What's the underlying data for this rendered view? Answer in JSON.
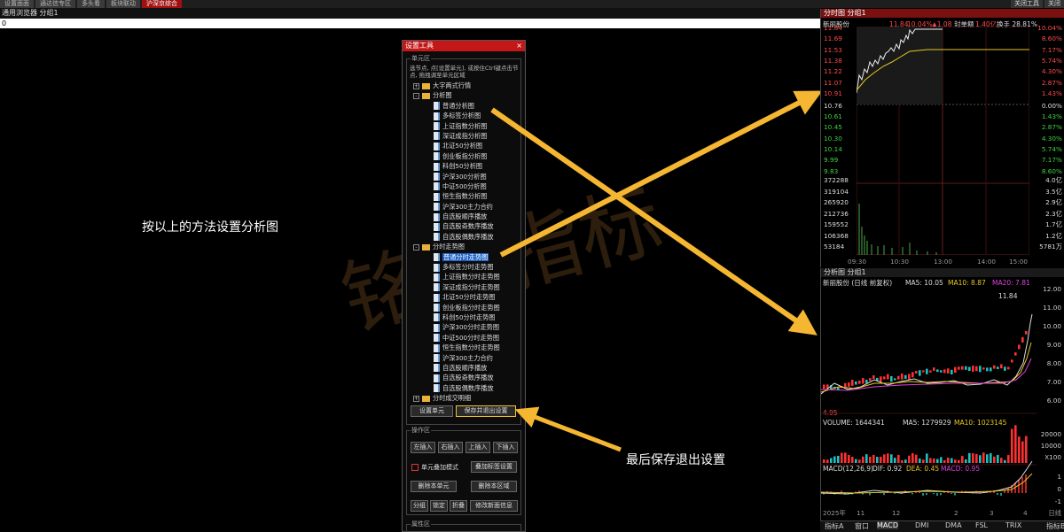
{
  "top_tabs": [
    "设置面面",
    "通达信专区",
    "多头看",
    "板块联动",
    "沪深京综合"
  ],
  "top_right": [
    "关闭工具",
    "关闭"
  ],
  "window_title": "通用浏览器 分组1",
  "address_value": "0",
  "annotations": {
    "left": "按以上的方法设置分析图",
    "bottom": "最后保存退出设置"
  },
  "watermark": "铭…指标",
  "dialog": {
    "title": "设置工具",
    "close": "×",
    "unit_group": "单元区",
    "hint": "选节点, 点[设置单元], 或按住Ctrl键点击节点, 拖拽调至单元区域",
    "tree": [
      {
        "label": "大字两式行情",
        "level": 0,
        "expand": "+",
        "type": "folder"
      },
      {
        "label": "分析图",
        "level": 0,
        "expand": "-",
        "type": "folder"
      },
      {
        "label": "普通分析图",
        "level": 1,
        "type": "doc"
      },
      {
        "label": "多标签分析图",
        "level": 1,
        "type": "doc"
      },
      {
        "label": "上证指数分析图",
        "level": 1,
        "type": "doc"
      },
      {
        "label": "深证成指分析图",
        "level": 1,
        "type": "doc"
      },
      {
        "label": "北证50分析图",
        "level": 1,
        "type": "doc"
      },
      {
        "label": "创业板指分析图",
        "level": 1,
        "type": "doc"
      },
      {
        "label": "科创50分析图",
        "level": 1,
        "type": "doc"
      },
      {
        "label": "沪深300分析图",
        "level": 1,
        "type": "doc"
      },
      {
        "label": "中证500分析图",
        "level": 1,
        "type": "doc"
      },
      {
        "label": "恒生指数分析图",
        "level": 1,
        "type": "doc"
      },
      {
        "label": "沪深300主力合约",
        "level": 1,
        "type": "doc"
      },
      {
        "label": "自选股顺序播放",
        "level": 1,
        "type": "doc"
      },
      {
        "label": "自选股奇数序播放",
        "level": 1,
        "type": "doc"
      },
      {
        "label": "自选股偶数序播放",
        "level": 1,
        "type": "doc"
      },
      {
        "label": "分时走势图",
        "level": 0,
        "expand": "-",
        "type": "folder"
      },
      {
        "label": "普通分时走势图",
        "level": 1,
        "type": "doc",
        "selected": true
      },
      {
        "label": "多标签分时走势图",
        "level": 1,
        "type": "doc"
      },
      {
        "label": "上证指数分时走势图",
        "level": 1,
        "type": "doc"
      },
      {
        "label": "深证成指分时走势图",
        "level": 1,
        "type": "doc"
      },
      {
        "label": "北证50分时走势图",
        "level": 1,
        "type": "doc"
      },
      {
        "label": "创业板指分时走势图",
        "level": 1,
        "type": "doc"
      },
      {
        "label": "科创50分时走势图",
        "level": 1,
        "type": "doc"
      },
      {
        "label": "沪深300分时走势图",
        "level": 1,
        "type": "doc"
      },
      {
        "label": "中证500分时走势图",
        "level": 1,
        "type": "doc"
      },
      {
        "label": "恒生指数分时走势图",
        "level": 1,
        "type": "doc"
      },
      {
        "label": "沪深300主力合约",
        "level": 1,
        "type": "doc"
      },
      {
        "label": "自选股顺序播放",
        "level": 1,
        "type": "doc"
      },
      {
        "label": "自选股奇数序播放",
        "level": 1,
        "type": "doc"
      },
      {
        "label": "自选股偶数序播放",
        "level": 1,
        "type": "doc"
      },
      {
        "label": "分时成交明细",
        "level": 0,
        "expand": "+",
        "type": "folder"
      }
    ],
    "set_unit": "设置单元",
    "save_exit": "保存并退出设置",
    "ops_group": "操作区",
    "ops": {
      "insert_left": "左插入",
      "insert_right": "右插入",
      "insert_top": "上插入",
      "insert_bottom": "下插入",
      "overlay_mode": "单元叠加模式",
      "overlay_tab_settings": "叠加标签设置",
      "delete_unit": "删除本单元",
      "delete_area": "删除本区域",
      "split": "分组",
      "lock": "锁定",
      "fold": "折叠",
      "edit_info": "修改新面信息"
    },
    "attr_group": "属性区"
  },
  "intraday": {
    "header": "分时图 分组1",
    "quote": {
      "name": "新丽股份",
      "price": "11.84",
      "pct": "10.04%",
      "change": "▲1.08",
      "seal_label": "封单额",
      "seal_val": "1.40亿",
      "turnover": "换手 28.81%"
    },
    "y_left_up": [
      "11.84",
      "11.69",
      "11.53",
      "11.38",
      "11.22",
      "11.07",
      "10.91"
    ],
    "y_left_mid": "10.76",
    "y_left_down": [
      "10.61",
      "10.45",
      "10.30",
      "10.14",
      "9.99",
      "9.83"
    ],
    "y_right_up": [
      "10.04%",
      "8.60%",
      "7.17%",
      "5.74%",
      "4.30%",
      "2.87%",
      "1.43%"
    ],
    "y_right_mid": "0.00%",
    "y_right_down": [
      "1.43%",
      "2.87%",
      "4.30%",
      "5.74%",
      "7.17%",
      "8.60%"
    ],
    "vol_left": [
      "372288",
      "319104",
      "265920",
      "212736",
      "159552",
      "106368",
      "53184"
    ],
    "vol_right": [
      "4.0亿",
      "3.5亿",
      "2.9亿",
      "2.3亿",
      "1.7亿",
      "1.2亿",
      "5781万"
    ],
    "x_labels": [
      "09:30",
      "10:30",
      "13:00",
      "14:00",
      "15:00"
    ]
  },
  "kline": {
    "header": "分析图 分组1",
    "legend": {
      "name": "新丽股份 (日线 前复权)",
      "ma5": "MA5: 10.05",
      "ma10": "MA10: 8.87",
      "ma20": "MA20: 7.81"
    },
    "high_label": "11.84",
    "low_label": "4.95",
    "y_right": [
      "12.00",
      "11.00",
      "10.00",
      "9.00",
      "8.00",
      "7.00",
      "6.00"
    ],
    "volume_legend": {
      "name": "VOLUME: 1644341",
      "ma5": "MA5: 1279929",
      "ma10": "MA10: 1023145"
    },
    "vol_right": [
      "20000",
      "10000",
      "X100"
    ],
    "macd_legend": {
      "name": "MACD(12,26,9)",
      "dif": "DIF: 0.92",
      "dea": "DEA: 0.45",
      "macd": "MACD: 0.95"
    },
    "macd_right": [
      "1",
      "0",
      "-1"
    ],
    "x_labels": [
      "2025年",
      "11",
      "12",
      "2",
      "3",
      "4"
    ],
    "x_right": "日线"
  },
  "bottom_tabs": [
    "指标A",
    "窗口",
    "MACD",
    "DMI",
    "DMA",
    "FSL",
    "TRIX",
    "指标B",
    "模",
    "板"
  ]
}
